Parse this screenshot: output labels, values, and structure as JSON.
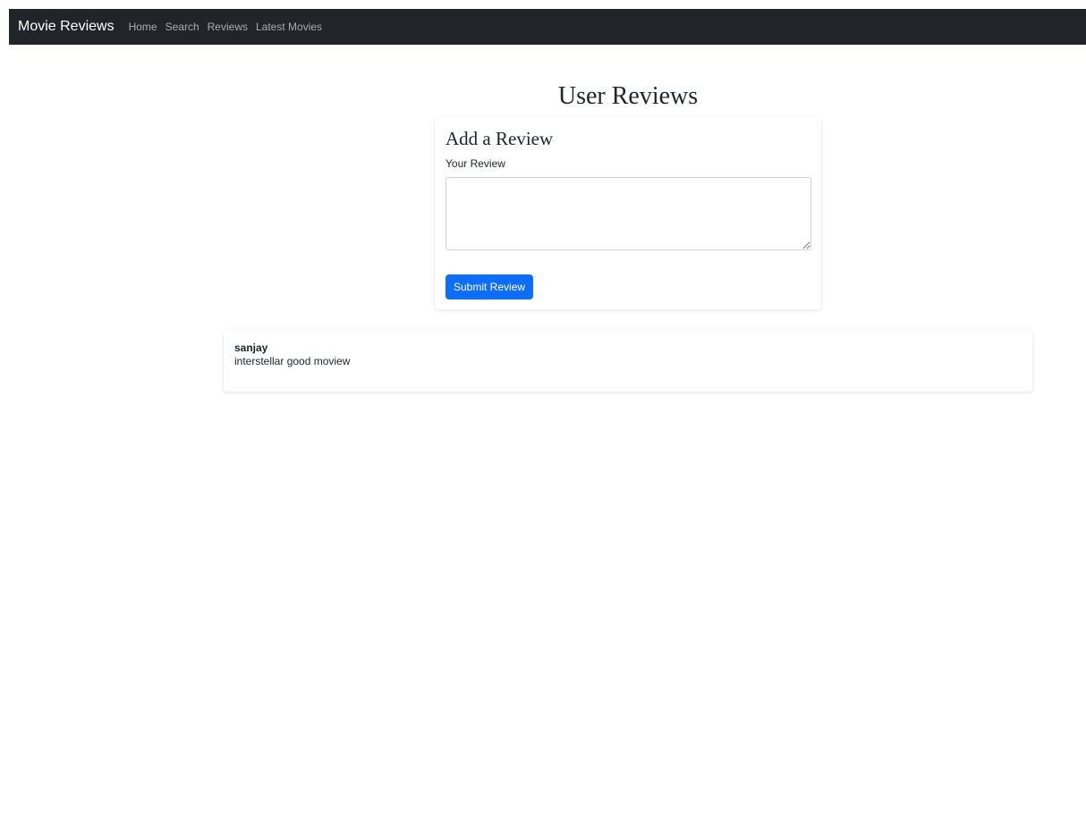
{
  "navbar": {
    "brand": "Movie Reviews",
    "links": [
      "Home",
      "Search",
      "Reviews",
      "Latest Movies"
    ]
  },
  "page": {
    "title": "User Reviews"
  },
  "form": {
    "title": "Add a Review",
    "label": "Your Review",
    "textarea_value": "",
    "submit_label": "Submit Review"
  },
  "reviews": [
    {
      "user": "sanjay",
      "text": "interstellar good moview"
    }
  ],
  "colors": {
    "navbar_bg": "#212529",
    "primary": "#0d6efd"
  }
}
